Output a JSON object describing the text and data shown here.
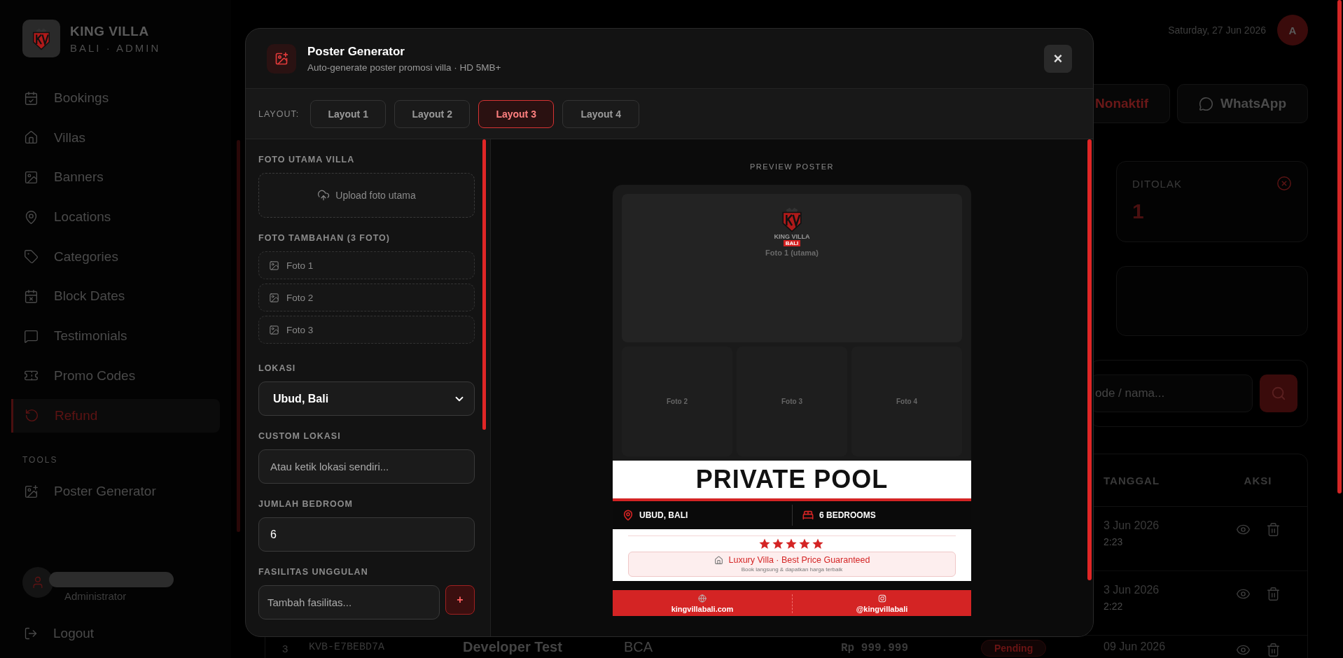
{
  "sidebar": {
    "brand": "KING VILLA",
    "tagline": "BALI · ADMIN",
    "nav": [
      {
        "label": "Bookings",
        "selected": false
      },
      {
        "label": "Villas",
        "selected": false
      },
      {
        "label": "Banners",
        "selected": false
      },
      {
        "label": "Locations",
        "selected": false
      },
      {
        "label": "Categories",
        "selected": false
      },
      {
        "label": "Block Dates",
        "selected": false
      },
      {
        "label": "Testimonials",
        "selected": false
      },
      {
        "label": "Promo Codes",
        "selected": false
      },
      {
        "label": "Refund",
        "selected": true
      }
    ],
    "tools_heading": "TOOLS",
    "tools": [
      {
        "label": "Poster Generator",
        "selected": false
      }
    ],
    "user": {
      "role": "Administrator"
    },
    "logout": "Logout"
  },
  "page": {
    "date": "Saturday, 27 Jun 2026",
    "avatar": "A",
    "actions": [
      {
        "kind": "toggle",
        "label": "Nonaktif"
      },
      {
        "kind": "whatsapp",
        "label": "WhatsApp"
      }
    ],
    "stat": {
      "label": "DITOLAK",
      "value": "1"
    },
    "search": {
      "placeholder": "ode / nama..."
    },
    "table": {
      "columns": [
        "TANGGAL",
        "AKSI"
      ],
      "rows": [
        {
          "date": "3 Jun 2026",
          "time": "2:23"
        },
        {
          "date": "3 Jun 2026",
          "time": "2:22"
        }
      ],
      "last_row": {
        "index": "3",
        "code": "KVB-E7BEBD7A",
        "name": "Developer Test",
        "bank": "BCA",
        "amount": "Rp 999.999",
        "status": "Pending",
        "date": "09 Jun 2026"
      }
    }
  },
  "modal": {
    "title": "Poster Generator",
    "subtitle": "Auto-generate poster promosi villa · HD 5MB+",
    "close": "×",
    "layout_label": "LAYOUT:",
    "layouts": [
      {
        "label": "Layout 1",
        "selected": false
      },
      {
        "label": "Layout 2",
        "selected": false
      },
      {
        "label": "Layout 3",
        "selected": true
      },
      {
        "label": "Layout 4",
        "selected": false
      }
    ],
    "form": {
      "main_photo_label": "FOTO UTAMA VILLA",
      "upload": "Upload foto utama",
      "extra_label": "FOTO TAMBAHAN (3 FOTO)",
      "extras": [
        "Foto 1",
        "Foto 2",
        "Foto 3"
      ],
      "location_label": "LOKASI",
      "location_value": "Ubud, Bali",
      "custom_label": "CUSTOM LOKASI",
      "custom_placeholder": "Atau ketik lokasi sendiri...",
      "bedroom_label": "JUMLAH BEDROOM",
      "bedroom_value": "6",
      "facility_label": "FASILITAS UNGGULAN",
      "facility_placeholder": "Tambah fasilitas...",
      "add": "+"
    },
    "preview": {
      "heading": "PREVIEW POSTER",
      "poster": {
        "logo_text": "KING VILLA",
        "logo_badge": "BALI",
        "main_photo": "Foto 1 (utama)",
        "photos": [
          "Foto 2",
          "Foto 3",
          "Foto 4"
        ],
        "headline": "PRIVATE POOL",
        "location": "UBUD, BALI",
        "bedrooms": "6 BEDROOMS",
        "stars": 5,
        "tagline": "Luxury Villa · Best Price Guaranteed",
        "subline": "Book langsung & dapatkan harga terbaik",
        "website": "kingvillabali.com",
        "instagram": "@kingvillabali"
      }
    }
  }
}
